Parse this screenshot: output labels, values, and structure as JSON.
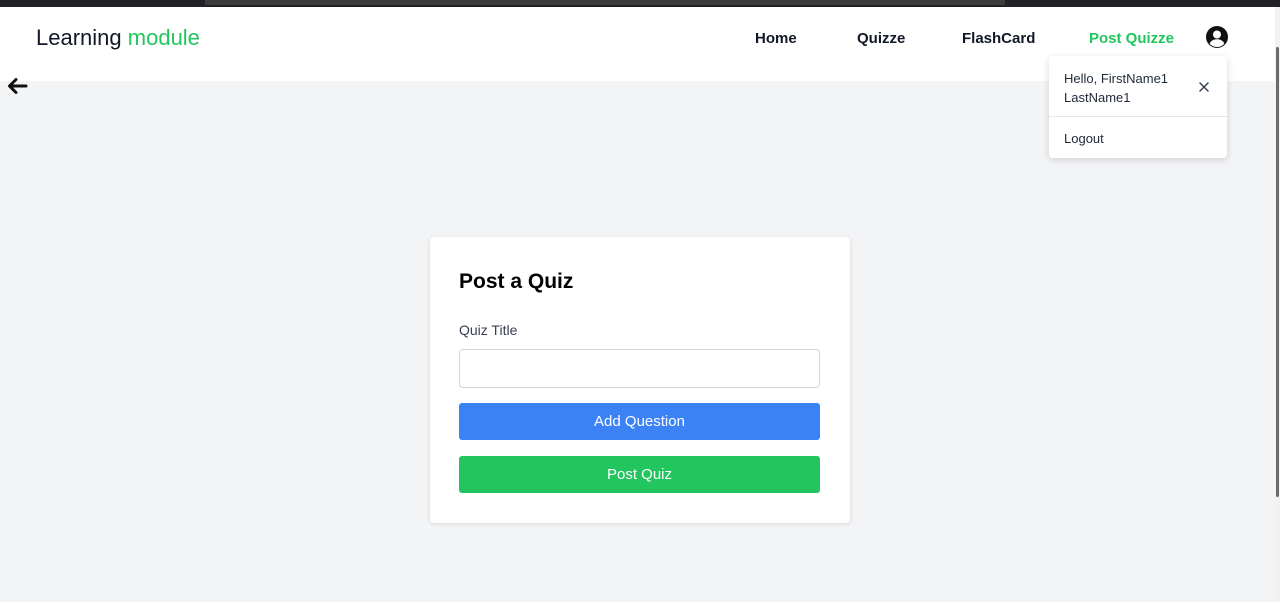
{
  "brand": {
    "prefix": "Learning",
    "accent": "module"
  },
  "nav": {
    "items": [
      {
        "label": "Home",
        "active": false
      },
      {
        "label": "Quizze",
        "active": false
      },
      {
        "label": "FlashCard",
        "active": false
      },
      {
        "label": "Post Quizze",
        "active": true
      }
    ],
    "profile_icon": "user-circle-icon"
  },
  "back_icon": "arrow-left-icon",
  "dropdown": {
    "greeting_line1": "Hello, FirstName1",
    "greeting_line2": "LastName1",
    "close_icon": "close-icon",
    "logout_label": "Logout"
  },
  "form": {
    "title": "Post a Quiz",
    "quiz_title_label": "Quiz Title",
    "quiz_title_value": "",
    "quiz_title_placeholder": "",
    "add_question_label": "Add Question",
    "post_quiz_label": "Post Quiz"
  },
  "colors": {
    "accent_green": "#22c55e",
    "button_blue": "#3b82f6",
    "background": "#f3f4f6"
  }
}
